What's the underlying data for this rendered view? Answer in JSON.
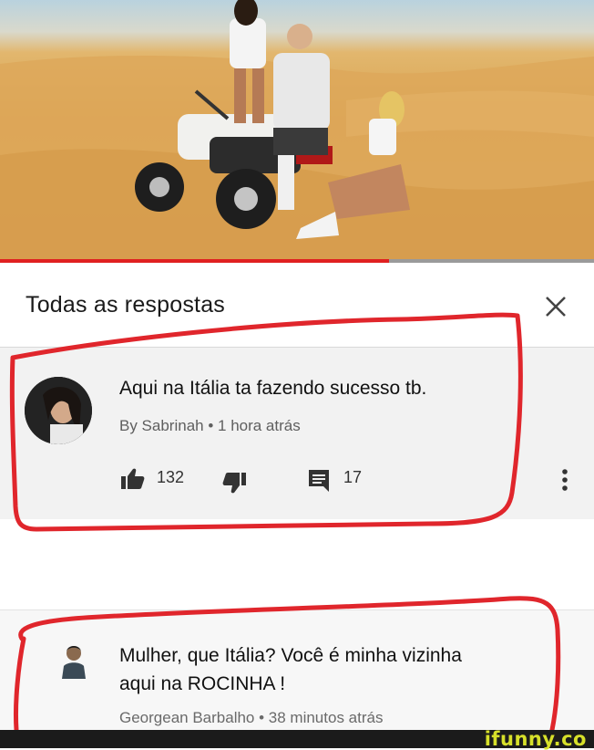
{
  "video": {
    "progress_fraction": 0.655
  },
  "header": {
    "title": "Todas as respostas",
    "close_icon": "close-icon"
  },
  "comment1": {
    "text": "Aqui na Itália ta fazendo sucesso tb.",
    "meta": "By Sabrinah • 1 hora atrás",
    "likes": "132",
    "replies": "17",
    "icons": [
      "thumbs-up-icon",
      "thumbs-down-icon",
      "reply-icon",
      "more-vert-icon"
    ]
  },
  "comment2": {
    "text_line1": "Mulher, que Itália? Você é minha vizinha",
    "text_line2": "aqui na ROCINHA !",
    "meta": "Georgean Barbalho • 38 minutos atrás"
  },
  "watermark": "ifunny.co",
  "colors": {
    "annotation_red": "#e0262c",
    "progress_red": "#e02020",
    "watermark": "#d7e02a"
  }
}
